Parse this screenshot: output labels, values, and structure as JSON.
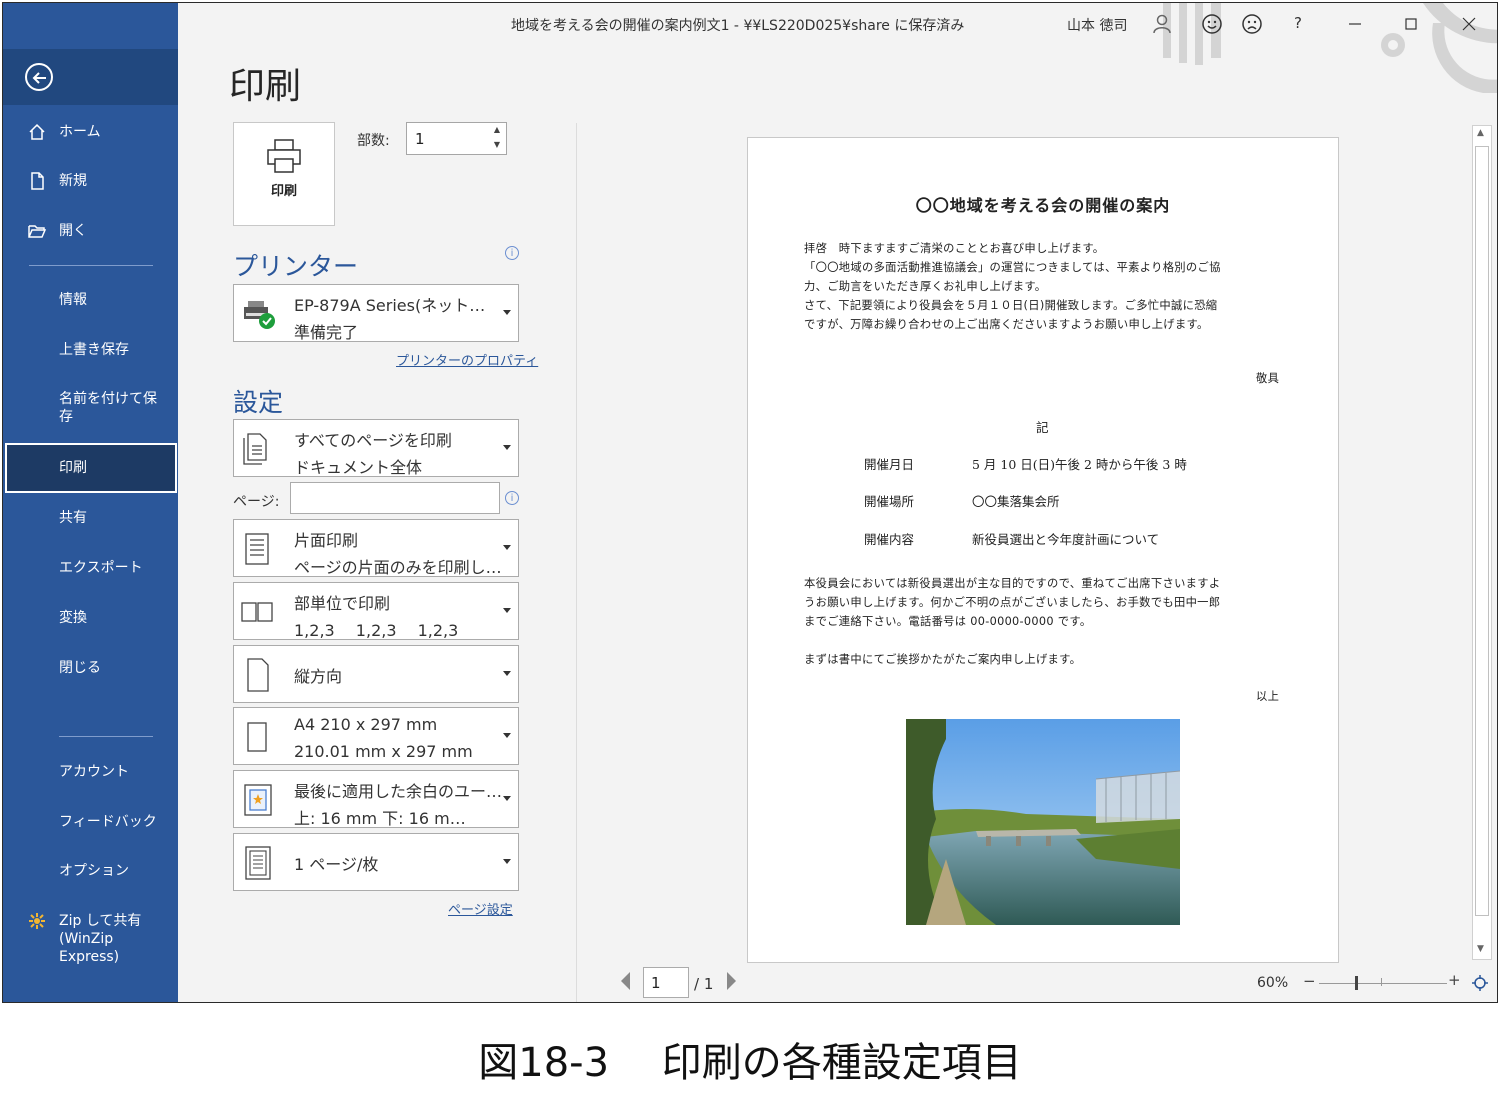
{
  "window": {
    "title": "地域を考える会の開催の案内例文1 - ¥¥LS220D025¥share に保存済み",
    "user": "山本 徳司",
    "help": "?"
  },
  "sidebar": {
    "top_items": [
      {
        "label": "ホーム",
        "icon": "home-icon"
      },
      {
        "label": "新規",
        "icon": "new-document-icon"
      },
      {
        "label": "開く",
        "icon": "open-folder-icon"
      }
    ],
    "items": [
      {
        "label": "情報"
      },
      {
        "label": "上書き保存"
      },
      {
        "label": "名前を付けて保存"
      },
      {
        "label": "印刷",
        "selected": true
      },
      {
        "label": "共有"
      },
      {
        "label": "エクスポート"
      },
      {
        "label": "変換"
      },
      {
        "label": "閉じる"
      }
    ],
    "bottom_items": [
      {
        "label": "アカウント"
      },
      {
        "label": "フィードバック"
      },
      {
        "label": "オプション"
      },
      {
        "label": "Zip して共有 (WinZip Express)",
        "icon": "winzip-icon"
      }
    ]
  },
  "main": {
    "heading": "印刷",
    "print_button": "印刷",
    "copies_label": "部数:",
    "copies_value": "1",
    "printer_heading": "プリンター",
    "printer_name": "EP-879A Series(ネット…",
    "printer_status": "準備完了",
    "printer_properties": "プリンターのプロパティ",
    "settings_heading": "設定",
    "settings": [
      {
        "line1": "すべてのページを印刷",
        "line2": "ドキュメント全体",
        "icon": "pages-icon"
      },
      {
        "line1": "片面印刷",
        "line2": "ページの片面のみを印刷し…",
        "icon": "one-sided-icon"
      },
      {
        "line1": "部単位で印刷",
        "line2": "1,2,3　 1,2,3　 1,2,3",
        "icon": "collate-icon"
      },
      {
        "line1": "縦方向",
        "line2": "",
        "icon": "portrait-icon"
      },
      {
        "line1": "A4 210 x 297 mm",
        "line2": "210.01 mm x 297 mm",
        "icon": "paper-size-icon"
      },
      {
        "line1": "最後に適用した余白のユー…",
        "line2": "上: 16 mm 下: 16 m…",
        "icon": "margins-icon"
      },
      {
        "line1": "1 ページ/枚",
        "line2": "",
        "icon": "pages-per-sheet-icon"
      }
    ],
    "pages_label": "ページ:",
    "pages_value": "",
    "page_setup": "ページ設定"
  },
  "preview": {
    "title": "〇〇地域を考える会の開催の案内",
    "para1": [
      "拝啓　時下ますますご清栄のこととお喜び申し上げます。",
      "「〇〇地域の多面活動推進協議会」の運営につきましては、平素より格別のご協",
      "力、ご助言をいただき厚くお礼申し上げます。",
      "さて、下記要領により役員会を５月１０日(日)開催致します。ご多忙中誠に恐縮",
      "ですが、万障お繰り合わせの上ご出席くださいますようお願い申し上げます。"
    ],
    "closing1": "敬具",
    "ki": "記",
    "details": [
      {
        "label": "開催月日",
        "value": "5 月 10 日(日)午後 2 時から午後 3 時"
      },
      {
        "label": "開催場所",
        "value": "〇〇集落集会所"
      },
      {
        "label": "開催内容",
        "value": "新役員選出と今年度計画について"
      }
    ],
    "para2": [
      "本役員会においては新役員選出が主な目的ですので、重ねてご出席下さいますよ",
      "うお願い申し上げます。何かご不明の点がございましたら、お手数でも田中一郎",
      "までご連絡下さい。電話番号は 00-0000-0000 です。"
    ],
    "para3": "まずは書中にてご挨拶かたがたご案内申し上げます。",
    "closing2": "以上",
    "current_page": "1",
    "total_pages": "/ 1",
    "zoom": "60%",
    "zoom_level_percent": 60
  },
  "caption": "図18-3　 印刷の各種設定項目"
}
